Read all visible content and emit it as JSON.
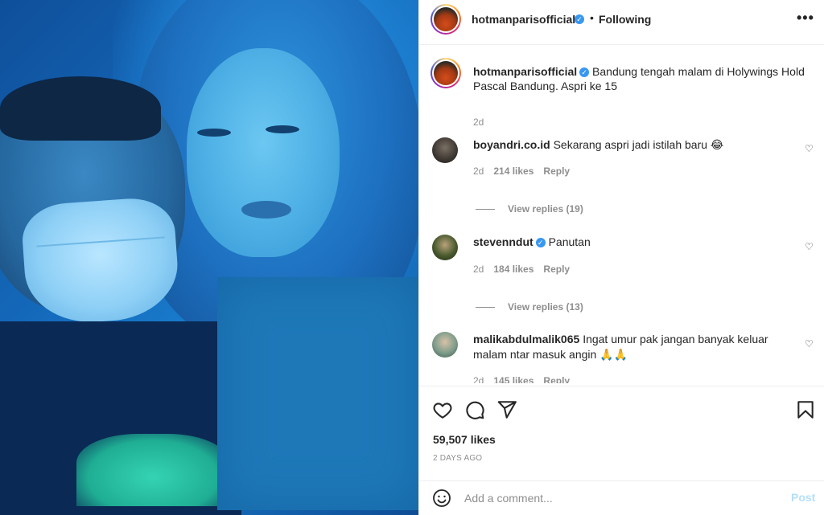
{
  "post": {
    "username": "hotmanparisofficial",
    "following_label": "Following",
    "dot": "•",
    "more": "•••"
  },
  "caption": {
    "username": "hotmanparisofficial",
    "text": "Bandung tengah malam di Holywings Hold Pascal Bandung. Aspri ke 15",
    "time": "2d"
  },
  "comments": [
    {
      "username": "boyandri.co.id",
      "text": "Sekarang aspri jadi istilah baru 😂",
      "time": "2d",
      "likes": "214 likes",
      "reply_label": "Reply",
      "view_replies": "View replies (19)",
      "verified": false
    },
    {
      "username": "stevenndut",
      "text": "Panutan",
      "time": "2d",
      "likes": "184 likes",
      "reply_label": "Reply",
      "view_replies": "View replies (13)",
      "verified": true
    },
    {
      "username": "malikabdulmalik065",
      "text": "Ingat umur pak jangan banyak keluar malam ntar masuk angin 🙏🙏",
      "time": "2d",
      "likes": "145 likes",
      "reply_label": "Reply",
      "verified": false
    }
  ],
  "actions": {
    "icons": [
      "heart-icon",
      "comment-icon",
      "share-icon",
      "bookmark-icon"
    ],
    "likes": "59,507 likes",
    "time": "2 DAYS AGO"
  },
  "add_comment": {
    "placeholder": "Add a comment...",
    "post_label": "Post"
  },
  "colors": {
    "verified": "#3897f0",
    "post_disabled": "#b2dffc",
    "muted": "#8e8e8e"
  }
}
